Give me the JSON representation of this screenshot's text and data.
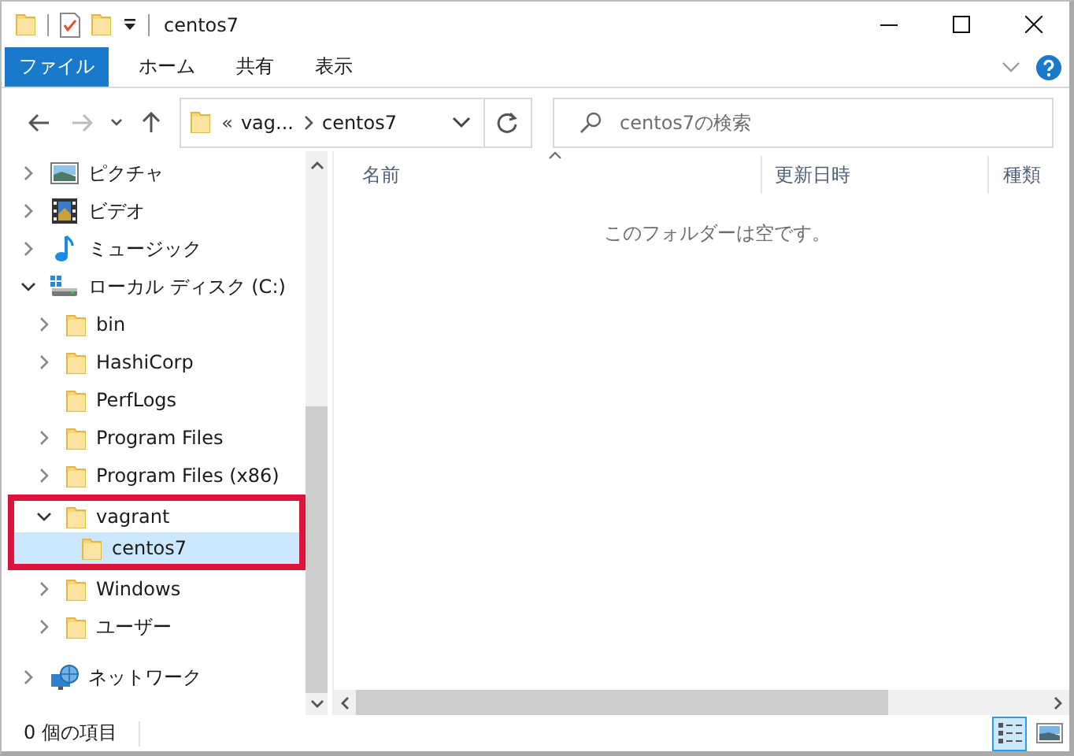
{
  "window": {
    "title": "centos7"
  },
  "ribbon": {
    "tabs": [
      {
        "label": "ファイル",
        "selected": true
      },
      {
        "label": "ホーム",
        "selected": false
      },
      {
        "label": "共有",
        "selected": false
      },
      {
        "label": "表示",
        "selected": false
      }
    ]
  },
  "address": {
    "overflow": "«",
    "crumbs": [
      "vag...",
      "centos7"
    ]
  },
  "search": {
    "placeholder": "centos7の検索"
  },
  "tree_groups": [
    {
      "items": [
        {
          "label": "ピクチャ",
          "kind": "pictures",
          "has_children": true,
          "expanded": false,
          "selected": false,
          "highlighted": false
        },
        {
          "label": "ビデオ",
          "kind": "videos",
          "has_children": true,
          "expanded": false,
          "selected": false,
          "highlighted": false
        },
        {
          "label": "ミュージック",
          "kind": "music",
          "has_children": true,
          "expanded": false,
          "selected": false,
          "highlighted": false
        },
        {
          "label": "ローカル ディスク (C:)",
          "kind": "drive",
          "has_children": true,
          "expanded": true,
          "selected": false,
          "highlighted": false,
          "children": [
            {
              "label": "bin",
              "kind": "folder",
              "has_children": true,
              "expanded": false,
              "selected": false,
              "highlighted": false
            },
            {
              "label": "HashiCorp",
              "kind": "folder",
              "has_children": true,
              "expanded": false,
              "selected": false,
              "highlighted": false
            },
            {
              "label": "PerfLogs",
              "kind": "folder",
              "has_children": false,
              "selected": false,
              "highlighted": false
            },
            {
              "label": "Program Files",
              "kind": "folder",
              "has_children": true,
              "expanded": false,
              "selected": false,
              "highlighted": false
            },
            {
              "label": "Program Files (x86)",
              "kind": "folder",
              "has_children": true,
              "expanded": false,
              "selected": false,
              "highlighted": false
            },
            {
              "label": "vagrant",
              "kind": "folder",
              "has_children": true,
              "expanded": true,
              "selected": false,
              "highlighted": true,
              "children": [
                {
                  "label": "centos7",
                  "kind": "folder",
                  "has_children": false,
                  "selected": true,
                  "highlighted": false
                }
              ]
            },
            {
              "label": "Windows",
              "kind": "folder",
              "has_children": true,
              "expanded": false,
              "selected": false,
              "highlighted": false
            },
            {
              "label": "ユーザー",
              "kind": "folder",
              "has_children": true,
              "expanded": false,
              "selected": false,
              "highlighted": false
            }
          ]
        }
      ]
    },
    {
      "items": [
        {
          "label": "ネットワーク",
          "kind": "network",
          "has_children": true,
          "expanded": false,
          "selected": false,
          "highlighted": false
        }
      ]
    }
  ],
  "columns": [
    {
      "label": "名前",
      "sorted": true
    },
    {
      "label": "更新日時",
      "sorted": false
    },
    {
      "label": "種類",
      "sorted": false
    }
  ],
  "empty_message": "このフォルダーは空です。",
  "status_bar": {
    "count": "0 個の項目",
    "views": [
      {
        "kind": "details",
        "selected": true
      },
      {
        "kind": "large-icons",
        "selected": false
      }
    ]
  }
}
